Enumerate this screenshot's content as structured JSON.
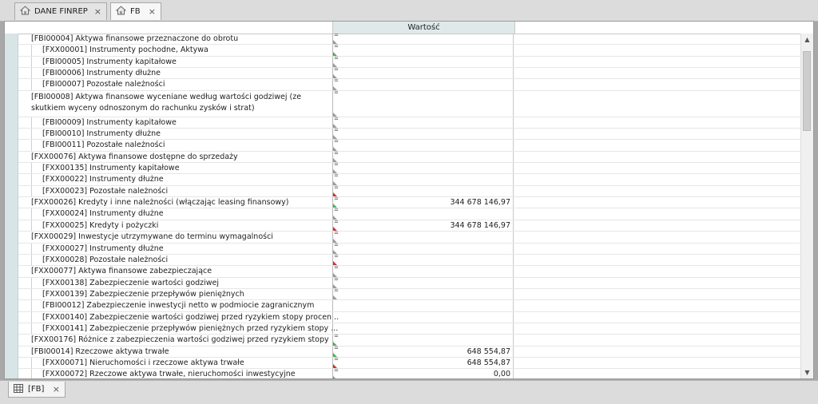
{
  "tabs": [
    {
      "label": "DANE FINREP",
      "icon": "home-icon"
    },
    {
      "label": "FB",
      "icon": "home-icon"
    }
  ],
  "table": {
    "column_header": "Wartość",
    "rows": [
      {
        "label": "[FBI00004] Aktywa finansowe przeznaczone do obrotu",
        "value": "",
        "marker": "gray",
        "indent": false,
        "tall": false
      },
      {
        "label": "[FXX00001] Instrumenty pochodne, Aktywa",
        "value": "",
        "marker": "green",
        "indent": true,
        "tall": false
      },
      {
        "label": "[FBI00005] Instrumenty kapitałowe",
        "value": "",
        "marker": "gray",
        "indent": true,
        "tall": false
      },
      {
        "label": "[FBI00006] Instrumenty dłużne",
        "value": "",
        "marker": "gray",
        "indent": true,
        "tall": false
      },
      {
        "label": "[FBI00007] Pozostałe należności",
        "value": "",
        "marker": "gray",
        "indent": true,
        "tall": false
      },
      {
        "label": "[FBI00008] Aktywa finansowe wyceniane według wartości godziwej (ze skutkiem wyceny odnoszonym do rachunku zysków i strat)",
        "value": "",
        "marker": "gray",
        "indent": false,
        "tall": true
      },
      {
        "label": "[FBI00009] Instrumenty kapitałowe",
        "value": "",
        "marker": "gray",
        "indent": true,
        "tall": false
      },
      {
        "label": "[FBI00010] Instrumenty dłużne",
        "value": "",
        "marker": "gray",
        "indent": true,
        "tall": false
      },
      {
        "label": "[FBI00011] Pozostałe należności",
        "value": "",
        "marker": "gray",
        "indent": true,
        "tall": false
      },
      {
        "label": "[FXX00076] Aktywa finansowe dostępne do sprzedaży",
        "value": "",
        "marker": "gray",
        "indent": false,
        "tall": false
      },
      {
        "label": "[FXX00135] Instrumenty kapitałowe",
        "value": "",
        "marker": "gray",
        "indent": true,
        "tall": false
      },
      {
        "label": "[FXX00022] Instrumenty dłużne",
        "value": "",
        "marker": "gray",
        "indent": true,
        "tall": false
      },
      {
        "label": "[FXX00023] Pozostałe należności",
        "value": "",
        "marker": "red",
        "indent": true,
        "tall": false
      },
      {
        "label": "[FXX00026] Kredyty i inne należności (włączając leasing finansowy)",
        "value": "344 678 146,97",
        "marker": "green",
        "indent": false,
        "tall": false
      },
      {
        "label": "[FXX00024] Instrumenty dłużne",
        "value": "",
        "marker": "gray",
        "indent": true,
        "tall": false
      },
      {
        "label": "[FXX00025] Kredyty i pożyczki",
        "value": "344 678 146,97",
        "marker": "red",
        "indent": true,
        "tall": false
      },
      {
        "label": "[FXX00029] Inwestycje utrzymywane do terminu wymagalności",
        "value": "",
        "marker": "gray",
        "indent": false,
        "tall": false
      },
      {
        "label": "[FXX00027] Instrumenty dłużne",
        "value": "",
        "marker": "gray",
        "indent": true,
        "tall": false
      },
      {
        "label": "[FXX00028] Pozostałe należności",
        "value": "",
        "marker": "red",
        "indent": true,
        "tall": false
      },
      {
        "label": "[FXX00077] Aktywa finansowe zabezpieczające",
        "value": "",
        "marker": "gray",
        "indent": false,
        "tall": false
      },
      {
        "label": "[FXX00138] Zabezpieczenie wartości godziwej",
        "value": "",
        "marker": "gray",
        "indent": true,
        "tall": false
      },
      {
        "label": "[FXX00139] Zabezpieczenie przepływów pieniężnych",
        "value": "",
        "marker": "gray",
        "indent": true,
        "tall": false
      },
      {
        "label": "[FBI00012] Zabezpieczenie inwestycji netto w podmiocie zagranicznym",
        "value": "",
        "marker": "none",
        "indent": true,
        "tall": false
      },
      {
        "label": "[FXX00140] Zabezpieczenie wartości godziwej przed ryzykiem stopy procen...",
        "value": "",
        "marker": "none",
        "indent": true,
        "tall": false
      },
      {
        "label": "[FXX00141] Zabezpieczenie przepływów pieniężnych przed ryzykiem stopy ...",
        "value": "",
        "marker": "none",
        "indent": true,
        "tall": false
      },
      {
        "label": "[FXX00176] Różnice z zabezpieczenia wartości godziwej przed ryzykiem stopy ...",
        "value": "",
        "marker": "green",
        "indent": false,
        "tall": false
      },
      {
        "label": "[FBI00014] Rzeczowe aktywa trwałe",
        "value": "648 554,87",
        "marker": "green",
        "indent": false,
        "tall": false
      },
      {
        "label": "[FXX00071] Nieruchomości i rzeczowe aktywa trwałe",
        "value": "648 554,87",
        "marker": "red",
        "indent": true,
        "tall": false
      },
      {
        "label": "[FXX00072] Rzeczowe aktywa trwałe, nieruchomości inwestycyjne",
        "value": "0,00",
        "marker": "green",
        "indent": true,
        "tall": false
      }
    ]
  },
  "bottom_tab": {
    "label": "[FB]",
    "icon": "grid-icon"
  },
  "colors": {
    "header_accent": "#dfe9ea",
    "gutter": "#d7e5e6",
    "green": "#4caf50",
    "red": "#d32f2f"
  }
}
